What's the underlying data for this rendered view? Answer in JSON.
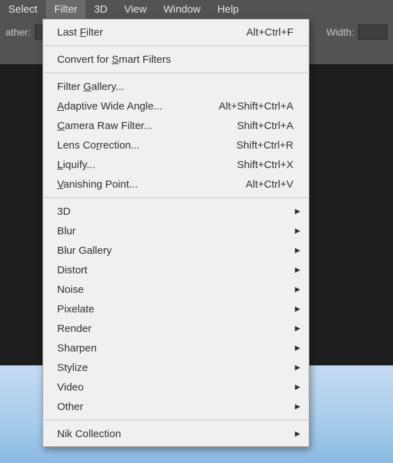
{
  "menubar": {
    "items": [
      {
        "label": "Select"
      },
      {
        "label": "Filter"
      },
      {
        "label": "3D"
      },
      {
        "label": "View"
      },
      {
        "label": "Window"
      },
      {
        "label": "Help"
      }
    ],
    "active": 1
  },
  "options_bar": {
    "left_label": "ather:",
    "width_label": "Width:"
  },
  "filter_menu": {
    "groups": [
      [
        {
          "pre": "Last ",
          "u": "F",
          "post": "ilter",
          "shortcut": "Alt+Ctrl+F"
        }
      ],
      [
        {
          "pre": "Convert for ",
          "u": "S",
          "post": "mart Filters"
        }
      ],
      [
        {
          "pre": "Filter ",
          "u": "G",
          "post": "allery..."
        },
        {
          "pre": "",
          "u": "A",
          "post": "daptive Wide Angle...",
          "shortcut": "Alt+Shift+Ctrl+A"
        },
        {
          "pre": "",
          "u": "C",
          "post": "amera Raw Filter...",
          "shortcut": "Shift+Ctrl+A"
        },
        {
          "pre": "Lens Co",
          "u": "r",
          "post": "rection...",
          "shortcut": "Shift+Ctrl+R"
        },
        {
          "pre": "",
          "u": "L",
          "post": "iquify...",
          "shortcut": "Shift+Ctrl+X"
        },
        {
          "pre": "",
          "u": "V",
          "post": "anishing Point...",
          "shortcut": "Alt+Ctrl+V"
        }
      ],
      [
        {
          "label": "3D",
          "submenu": true
        },
        {
          "label": "Blur",
          "submenu": true
        },
        {
          "label": "Blur Gallery",
          "submenu": true
        },
        {
          "label": "Distort",
          "submenu": true
        },
        {
          "label": "Noise",
          "submenu": true
        },
        {
          "label": "Pixelate",
          "submenu": true
        },
        {
          "label": "Render",
          "submenu": true
        },
        {
          "label": "Sharpen",
          "submenu": true
        },
        {
          "label": "Stylize",
          "submenu": true
        },
        {
          "label": "Video",
          "submenu": true
        },
        {
          "label": "Other",
          "submenu": true
        }
      ],
      [
        {
          "label": "Nik Collection",
          "submenu": true
        }
      ]
    ]
  }
}
